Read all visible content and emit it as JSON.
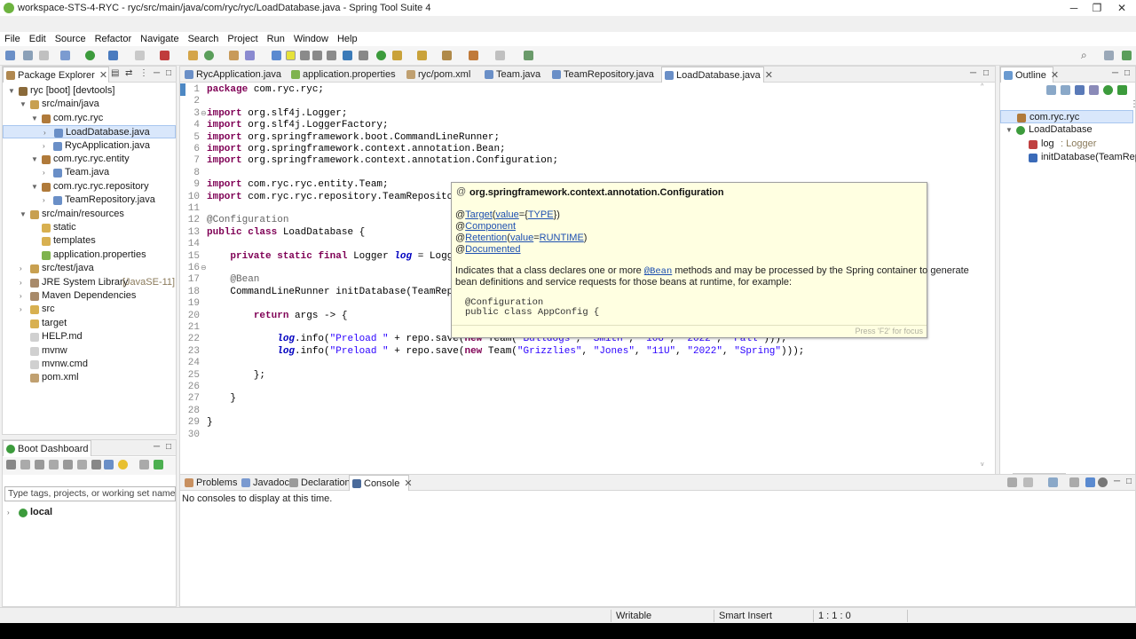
{
  "window": {
    "title": "workspace-STS-4-RYC - ryc/src/main/java/com/ryc/ryc/LoadDatabase.java - Spring Tool Suite 4"
  },
  "menu": [
    "File",
    "Edit",
    "Source",
    "Refactor",
    "Navigate",
    "Search",
    "Project",
    "Run",
    "Window",
    "Help"
  ],
  "package_explorer": {
    "title": "Package Explorer",
    "items": [
      {
        "label": "ryc [boot] [devtools]",
        "arrow": "▼",
        "level": 0,
        "icon": "project-icon"
      },
      {
        "label": "src/main/java",
        "arrow": "▼",
        "level": 1,
        "icon": "source-folder-icon"
      },
      {
        "label": "com.ryc.ryc",
        "arrow": "▼",
        "level": 2,
        "icon": "package-icon"
      },
      {
        "label": "LoadDatabase.java",
        "arrow": "›",
        "level": 3,
        "icon": "java-file-icon",
        "selected": true
      },
      {
        "label": "RycApplication.java",
        "arrow": "›",
        "level": 3,
        "icon": "java-file-icon"
      },
      {
        "label": "com.ryc.ryc.entity",
        "arrow": "▼",
        "level": 2,
        "icon": "package-icon"
      },
      {
        "label": "Team.java",
        "arrow": "›",
        "level": 3,
        "icon": "java-file-icon"
      },
      {
        "label": "com.ryc.ryc.repository",
        "arrow": "▼",
        "level": 2,
        "icon": "package-icon"
      },
      {
        "label": "TeamRepository.java",
        "arrow": "›",
        "level": 3,
        "icon": "java-file-icon"
      },
      {
        "label": "src/main/resources",
        "arrow": "▼",
        "level": 1,
        "icon": "source-folder-icon"
      },
      {
        "label": "static",
        "arrow": "",
        "level": 2,
        "icon": "folder-icon"
      },
      {
        "label": "templates",
        "arrow": "",
        "level": 2,
        "icon": "folder-icon"
      },
      {
        "label": "application.properties",
        "arrow": "",
        "level": 2,
        "icon": "properties-file-icon"
      },
      {
        "label": "src/test/java",
        "arrow": "›",
        "level": 1,
        "icon": "source-folder-icon"
      },
      {
        "label": "JRE System Library",
        "suffix": "[JavaSE-11]",
        "arrow": "›",
        "level": 1,
        "icon": "library-icon"
      },
      {
        "label": "Maven Dependencies",
        "arrow": "›",
        "level": 1,
        "icon": "library-icon"
      },
      {
        "label": "src",
        "arrow": "›",
        "level": 1,
        "icon": "folder-icon"
      },
      {
        "label": "target",
        "arrow": "",
        "level": 1,
        "icon": "folder-icon"
      },
      {
        "label": "HELP.md",
        "arrow": "",
        "level": 1,
        "icon": "file-icon"
      },
      {
        "label": "mvnw",
        "arrow": "",
        "level": 1,
        "icon": "file-icon"
      },
      {
        "label": "mvnw.cmd",
        "arrow": "",
        "level": 1,
        "icon": "file-icon"
      },
      {
        "label": "pom.xml",
        "arrow": "",
        "level": 1,
        "icon": "xml-file-icon"
      }
    ]
  },
  "boot_dashboard": {
    "title": "Boot Dashboard",
    "filter_placeholder": "Type tags, projects, or working set names t",
    "local_label": "local"
  },
  "editor": {
    "tabs": [
      "RycApplication.java",
      "application.properties",
      "ryc/pom.xml",
      "Team.java",
      "TeamRepository.java",
      "LoadDatabase.java"
    ],
    "active_tab": "LoadDatabase.java",
    "lines": [
      "package com.ryc.ryc;",
      "",
      "import org.slf4j.Logger;",
      "import org.slf4j.LoggerFactory;",
      "import org.springframework.boot.CommandLineRunner;",
      "import org.springframework.context.annotation.Bean;",
      "import org.springframework.context.annotation.Configuration;",
      "",
      "import com.ryc.ryc.entity.Team;",
      "import com.ryc.ryc.repository.TeamRepository;",
      "",
      "@Configuration",
      "public class LoadDatabase {",
      "",
      "    private static final Logger log = LoggerFa",
      "",
      "    @Bean",
      "    CommandLineRunner initDatabase(TeamReposit",
      "",
      "        return args -> {",
      "",
      "            log.info(\"Preload \" + repo.save(new Team(\"Bulldogs\", \"Smith\", \"10U\", \"2022\", \"Fall\")));",
      "            log.info(\"Preload \" + repo.save(new Team(\"Grizzlies\", \"Jones\", \"11U\", \"2022\", \"Spring\")));",
      "",
      "        };",
      "",
      "    }",
      "",
      "}",
      ""
    ]
  },
  "hover": {
    "title": "org.springframework.context.annotation.Configuration",
    "line_target": "@Target(value={TYPE})",
    "line_component": "@Component",
    "line_retention": "@Retention(value=RUNTIME)",
    "line_documented": "@Documented",
    "desc_1a": "Indicates that a class declares one or more ",
    "desc_1b": "@Bean",
    "desc_1c": " methods and may be processed by the Spring container to generate",
    "desc_2": "bean definitions and service requests for those beans at runtime, for example:",
    "code_1": "@Configuration",
    "code_2": "public class AppConfig {",
    "hint": "Press 'F2' for focus"
  },
  "outline": {
    "title": "Outline",
    "items": [
      {
        "label": "com.ryc.ryc",
        "icon": "package-icon",
        "level": 0
      },
      {
        "label": "LoadDatabase",
        "icon": "class-icon",
        "level": 0,
        "arrow": "▼"
      },
      {
        "label": "log",
        "type": " : Logger",
        "icon": "field-icon",
        "level": 1
      },
      {
        "label": "initDatabase(TeamRepo",
        "icon": "method-icon",
        "level": 1
      }
    ]
  },
  "bottom": {
    "tabs": [
      "Problems",
      "Javadoc",
      "Declaration",
      "Console"
    ],
    "active_tab": "Console",
    "message": "No consoles to display at this time."
  },
  "status": {
    "writable": "Writable",
    "insert_mode": "Smart Insert",
    "position": "1 : 1 : 0"
  },
  "colors": {
    "keyword": "#7f0055",
    "string": "#2a00ff",
    "annotation": "#646464",
    "field": "#0000c0",
    "hover_bg": "#ffffe1",
    "spring_green": "#6db33f"
  }
}
